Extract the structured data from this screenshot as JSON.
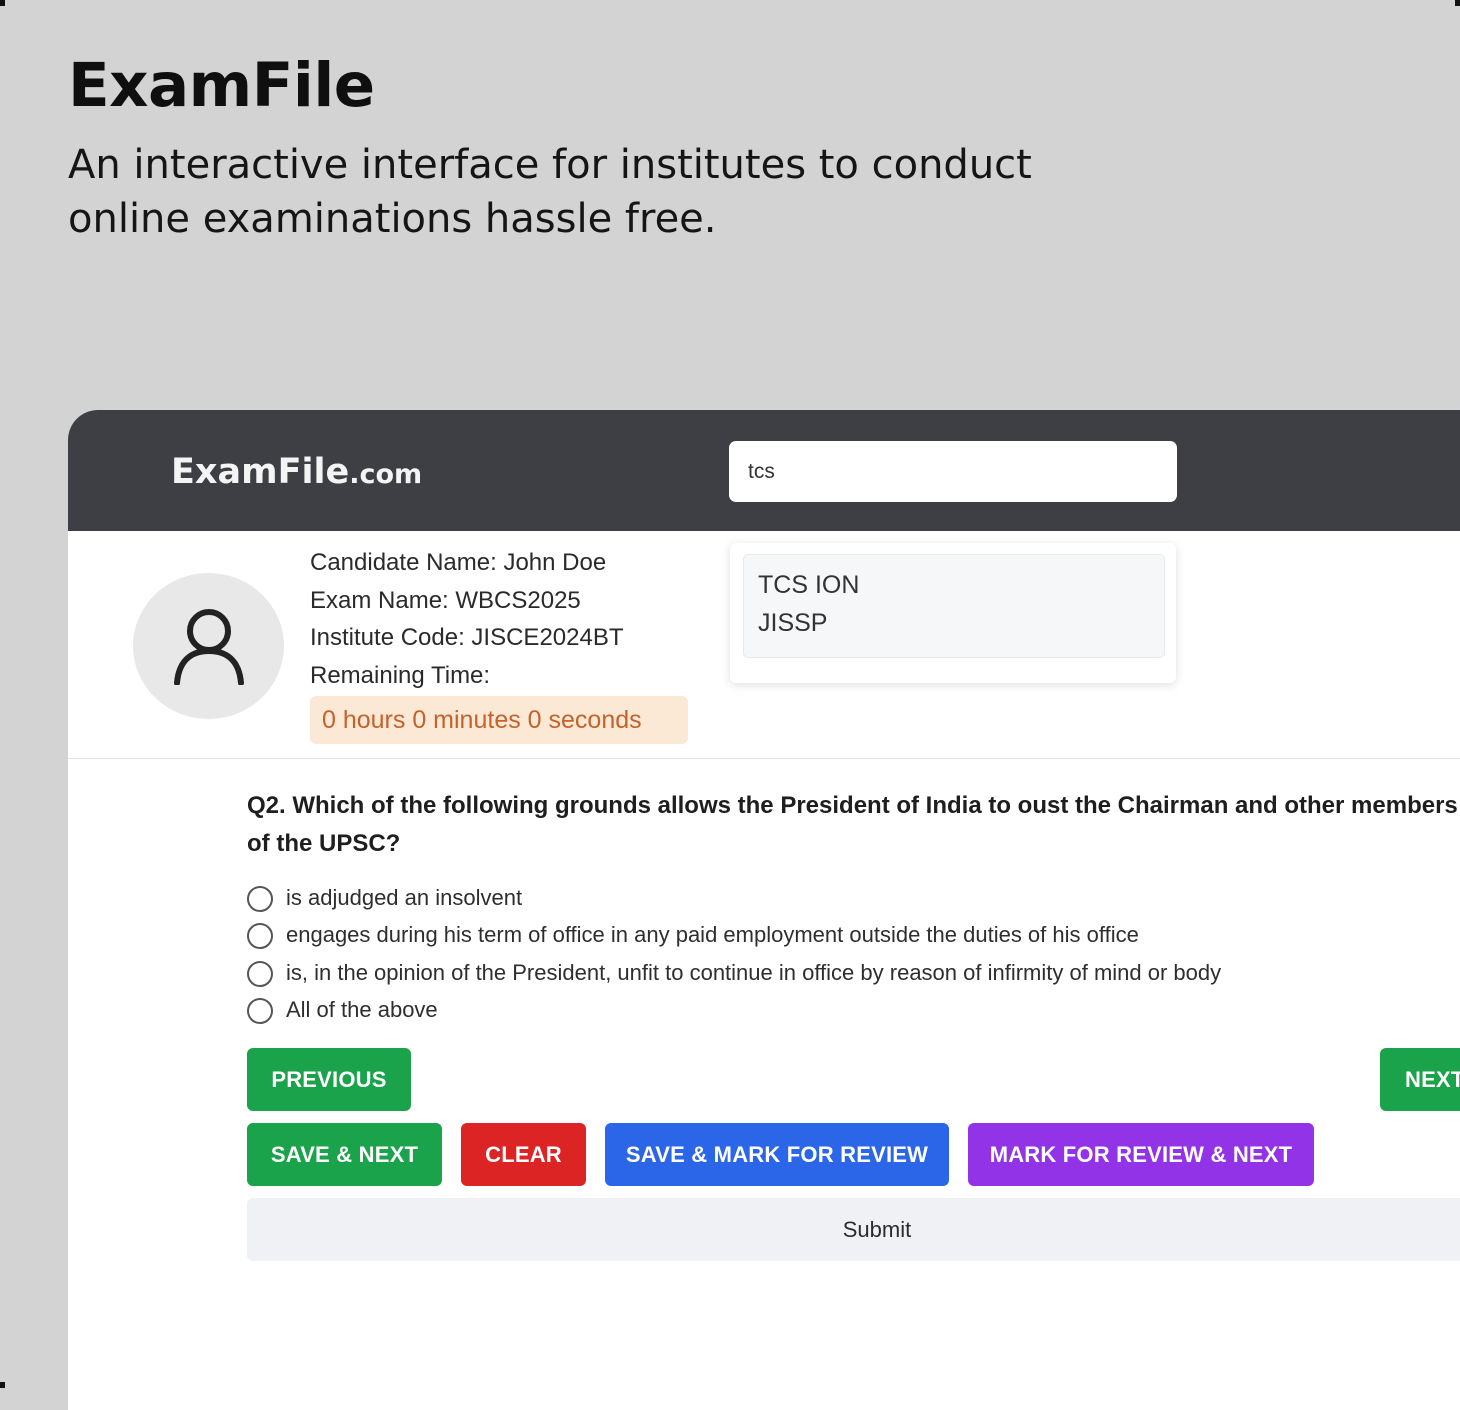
{
  "hero": {
    "title": "ExamFile",
    "subtitle": "An interactive interface for institutes to conduct online examinations hassle free."
  },
  "navbar": {
    "brand_main": "ExamFile",
    "brand_tld": ".com",
    "search_value": "tcs"
  },
  "search_suggestions": [
    "TCS ION",
    "JISSP"
  ],
  "candidate": {
    "name_line": "Candidate Name: John Doe",
    "exam_line": "Exam Name: WBCS2025",
    "institute_line": "Institute Code: JISCE2024BT",
    "remaining_label": "Remaining Time:",
    "timer": "0 hours 0 minutes 0 seconds"
  },
  "question": {
    "text": "Q2. Which of the following grounds allows the President of India to oust the Chairman and other members of the UPSC?",
    "options": [
      "is adjudged an insolvent",
      "engages during his term of office in any paid employment outside the duties of his office",
      "is, in the opinion of the President, unfit to continue in office by reason of infirmity of mind or body",
      "All of the above"
    ]
  },
  "buttons": {
    "previous": "PREVIOUS",
    "next": "NEXT",
    "save_next": "SAVE & NEXT",
    "clear": "CLEAR",
    "save_mark_review": "SAVE & MARK FOR REVIEW",
    "mark_review_next": "MARK FOR REVIEW & NEXT",
    "submit": "Submit"
  },
  "colors": {
    "page_bg": "#d3d3d3",
    "navbar": "#3d3f44",
    "green": "#1aa34a",
    "red": "#dc2424",
    "blue": "#2b66e8",
    "purple": "#9333e8",
    "timer_bg": "#fbe9d5",
    "timer_text": "#c5612b"
  },
  "icons": {
    "avatar": "user-icon",
    "radio": "radio-circle"
  }
}
